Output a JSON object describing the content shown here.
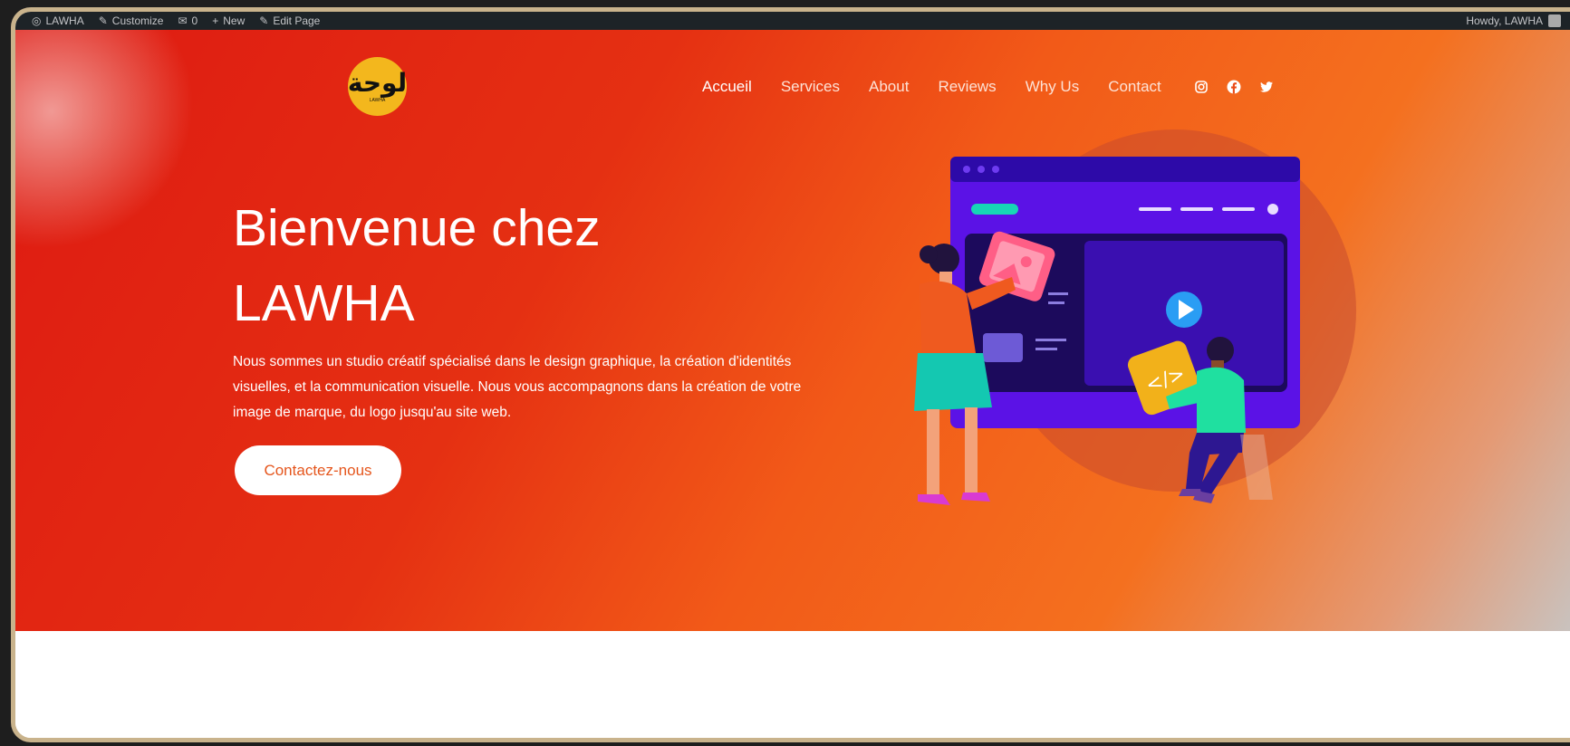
{
  "admin_bar": {
    "items": [
      {
        "label": "LAWHA",
        "icon": "wordpress-icon"
      },
      {
        "label": "Customize",
        "icon": "brush-icon"
      },
      {
        "label": "0",
        "icon": "comment-icon"
      },
      {
        "label": "New",
        "icon": "plus-icon"
      },
      {
        "label": "Edit Page",
        "icon": "pencil-icon"
      }
    ],
    "greeting": "Howdy, LAWHA"
  },
  "logo": {
    "mark": "لوحة",
    "subtitle": "LAWHA"
  },
  "nav": {
    "links": [
      "Accueil",
      "Services",
      "About",
      "Reviews",
      "Why Us",
      "Contact"
    ],
    "active": "Accueil",
    "social_icons": [
      "instagram-icon",
      "facebook-icon",
      "twitter-icon"
    ]
  },
  "hero": {
    "title_line1": "Bienvenue chez",
    "title_line2": "LAWHA",
    "description": "Nous sommes un studio créatif spécialisé dans le design graphique, la création d'identités visuelles, et la communication visuelle. Nous vous accompagnons dans la création de votre image de marque, du logo jusqu'au site web.",
    "cta_label": "Contactez-nous"
  },
  "colors": {
    "frame_border": "#c9b38c",
    "gradient_start": "#de1a12",
    "gradient_mid": "#f25a18",
    "accent_orange": "#e5561d",
    "illustration_purple": "#5b12e6",
    "logo_yellow": "#f3b71d"
  }
}
